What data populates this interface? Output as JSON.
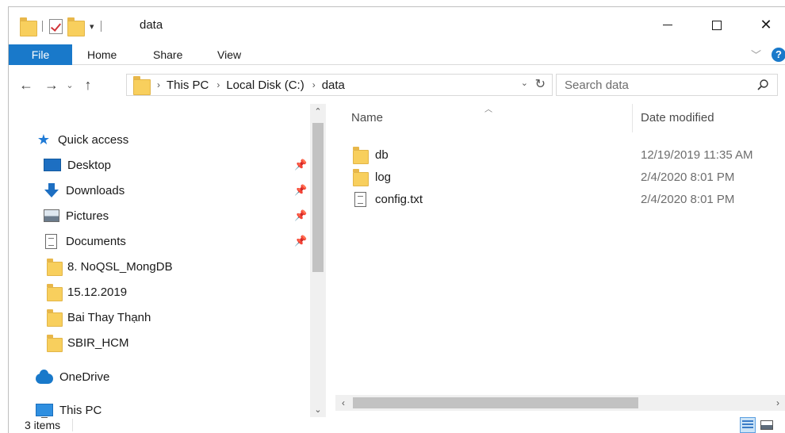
{
  "window": {
    "title": "data",
    "controls": {
      "minimize": "minimize",
      "maximize": "maximize",
      "close": "✕"
    }
  },
  "ribbon": {
    "tabs": [
      {
        "label": "File",
        "active": true
      },
      {
        "label": "Home"
      },
      {
        "label": "Share"
      },
      {
        "label": "View"
      }
    ]
  },
  "address": {
    "crumbs": [
      "This PC",
      "Local Disk (C:)",
      "data"
    ]
  },
  "search": {
    "placeholder": "Search data"
  },
  "nav_pane": {
    "quick_access": "Quick access",
    "items": [
      {
        "label": "Desktop",
        "icon": "desktop-icon",
        "pinned": true
      },
      {
        "label": "Downloads",
        "icon": "downloads-icon",
        "pinned": true
      },
      {
        "label": "Pictures",
        "icon": "pictures-icon",
        "pinned": true
      },
      {
        "label": "Documents",
        "icon": "documents-icon",
        "pinned": true
      },
      {
        "label": "8. NoQSL_MongDB",
        "icon": "folder-icon"
      },
      {
        "label": "15.12.2019",
        "icon": "folder-icon"
      },
      {
        "label": "Bai Thay Thạnh",
        "icon": "folder-icon"
      },
      {
        "label": "SBIR_HCM",
        "icon": "folder-icon"
      }
    ],
    "onedrive": "OneDrive",
    "this_pc": "This PC"
  },
  "columns": {
    "name": "Name",
    "date_modified": "Date modified"
  },
  "files": [
    {
      "name": "db",
      "date": "12/19/2019 11:35 AM",
      "icon": "folder-icon"
    },
    {
      "name": "log",
      "date": "2/4/2020 8:01 PM",
      "icon": "folder-icon"
    },
    {
      "name": "config.txt",
      "date": "2/4/2020 8:01 PM",
      "icon": "text-file-icon"
    }
  ],
  "status": {
    "items_count": "3 items"
  },
  "colors": {
    "accent": "#1979ca",
    "folder": "#f8cf5d"
  }
}
